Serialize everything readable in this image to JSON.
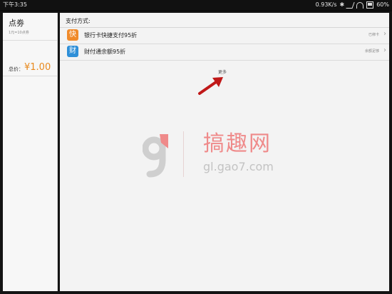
{
  "status_bar": {
    "time": "下午3:35",
    "network_speed": "0.93K/s",
    "battery": "60%",
    "icons": [
      "bluetooth-icon",
      "signal-icon",
      "wifi-icon",
      "battery-icon"
    ]
  },
  "sidebar": {
    "title": "点劵",
    "subtitle": "1元=10点劵",
    "total_label": "总价：",
    "total_value": "¥1.00"
  },
  "main": {
    "heading": "支付方式:",
    "methods": [
      {
        "badge": "快",
        "badge_color": "#f08a2a",
        "label": "银行卡快捷支付95折",
        "status": "已绑卡"
      },
      {
        "badge": "财",
        "badge_color": "#2e8fd8",
        "label": "财付通余额95折",
        "status": "余额足够"
      }
    ],
    "more_label": "更多"
  },
  "watermark": {
    "title": "搞趣网",
    "url": "gl.gao7.com"
  },
  "colors": {
    "accent_orange": "#e8891d",
    "arrow_red": "#c01818",
    "watermark_pink": "#ef8a8a"
  }
}
